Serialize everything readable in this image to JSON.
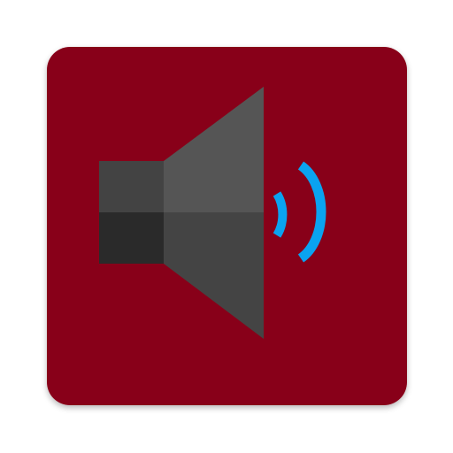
{
  "app_icon": {
    "name": "speaker-volume-icon",
    "colors": {
      "background": "#880019",
      "speaker_body_top": "#434343",
      "speaker_body_bottom": "#2a2a2a",
      "speaker_cone_top": "#555555",
      "speaker_cone_bottom": "#444444",
      "sound_wave": "#0aa3f0"
    },
    "sound_waves_count": 2
  }
}
